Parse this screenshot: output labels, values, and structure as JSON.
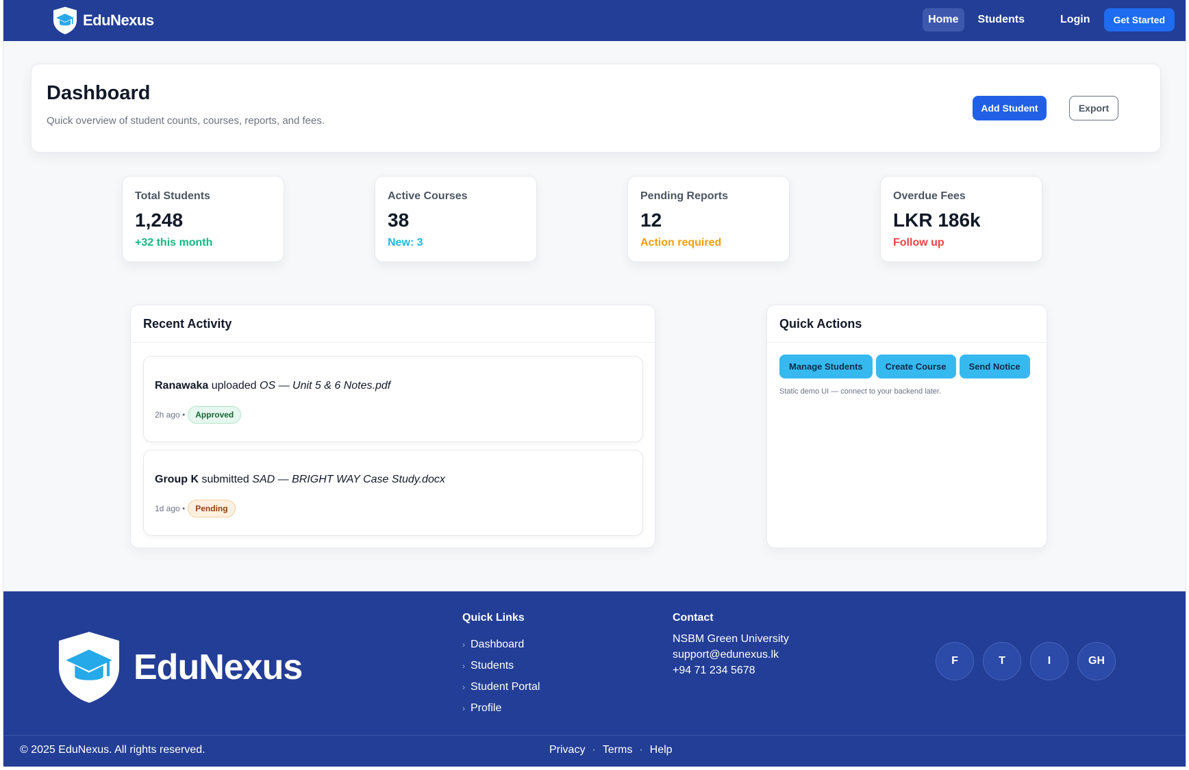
{
  "colors": {
    "brand_navy": "#233e96",
    "primary": "#2160e6",
    "accent_cyan": "#36b9ef",
    "success": "#10b981",
    "info": "#22b6e3",
    "warning": "#f59e0b",
    "danger": "#ef4444"
  },
  "header": {
    "brand": "EduNexus",
    "logo_icon": "shield-graduation-cap-icon",
    "nav": {
      "home": "Home",
      "students": "Students",
      "login": "Login"
    },
    "cta": "Get Started"
  },
  "dashboard": {
    "title": "Dashboard",
    "subtitle": "Quick overview of student counts, courses, reports, and fees.",
    "add_student": "Add Student",
    "export": "Export"
  },
  "stats": [
    {
      "label": "Total Students",
      "value": "1,248",
      "note": "+32 this month"
    },
    {
      "label": "Active Courses",
      "value": "38",
      "note": "New: 3"
    },
    {
      "label": "Pending Reports",
      "value": "12",
      "note": "Action required"
    },
    {
      "label": "Overdue Fees",
      "value": "LKR 186k",
      "note": "Follow up"
    }
  ],
  "activity": {
    "title": "Recent Activity",
    "items": [
      {
        "actor": "Ranawaka",
        "verb": "uploaded",
        "file": "OS — Unit 5 & 6 Notes.pdf",
        "time": "2h ago •",
        "status": "Approved"
      },
      {
        "actor": "Group K",
        "verb": "submitted",
        "file": "SAD — BRIGHT WAY Case Study.docx",
        "time": "1d ago •",
        "status": "Pending"
      }
    ]
  },
  "quick_actions": {
    "title": "Quick Actions",
    "buttons": [
      "Manage Students",
      "Create Course",
      "Send Notice"
    ],
    "note": "Static demo UI — connect to your backend later."
  },
  "footer": {
    "brand": "EduNexus",
    "quick_links_title": "Quick Links",
    "quick_links": [
      "Dashboard",
      "Students",
      "Student Portal",
      "Profile"
    ],
    "contact_title": "Contact",
    "contact": [
      "NSBM Green University",
      "support@edunexus.lk",
      "+94 71 234 5678"
    ],
    "socials": [
      "F",
      "T",
      "I",
      "GH"
    ],
    "copyright": "© 2025 EduNexus. All rights reserved.",
    "legal": [
      "Privacy",
      "Terms",
      "Help"
    ]
  }
}
